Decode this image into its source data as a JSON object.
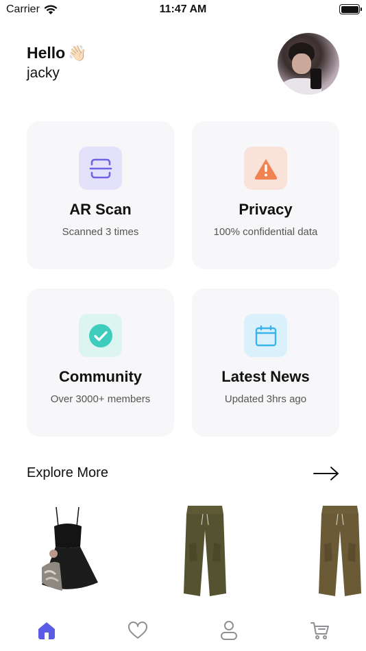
{
  "status_bar": {
    "carrier": "Carrier",
    "time": "11:47 AM"
  },
  "greeting": {
    "hello": "Hello",
    "wave_emoji": "👋🏻",
    "username": "jacky"
  },
  "cards": [
    {
      "title": "AR Scan",
      "subtitle": "Scanned 3 times",
      "icon": "scan-icon",
      "icon_bg": "#e4e2fb",
      "icon_color": "#6c63e6"
    },
    {
      "title": "Privacy",
      "subtitle": "100% confidential data",
      "icon": "warning-icon",
      "icon_bg": "#f8e2da",
      "icon_color": "#f0834f"
    },
    {
      "title": "Community",
      "subtitle": "Over 3000+ members",
      "icon": "check-circle-icon",
      "icon_bg": "#ddf5f1",
      "icon_color": "#3ecdbc"
    },
    {
      "title": "Latest News",
      "subtitle": "Updated 3hrs ago",
      "icon": "calendar-icon",
      "icon_bg": "#daf0fb",
      "icon_color": "#3ab2ea"
    }
  ],
  "explore": {
    "title": "Explore More",
    "arrow_icon": "arrow-right-icon",
    "products": [
      {
        "name": "black-dress-image",
        "kind": "dress"
      },
      {
        "name": "cargo-pants-image",
        "kind": "pants"
      },
      {
        "name": "cargo-pants-image",
        "kind": "pants"
      }
    ]
  },
  "tab_bar": {
    "accent": "#5b5ce6",
    "inactive": "#8e8e93",
    "tabs": [
      {
        "icon": "home-icon",
        "active": true
      },
      {
        "icon": "heart-icon",
        "active": false
      },
      {
        "icon": "profile-icon",
        "active": false
      },
      {
        "icon": "cart-icon",
        "active": false
      }
    ]
  }
}
